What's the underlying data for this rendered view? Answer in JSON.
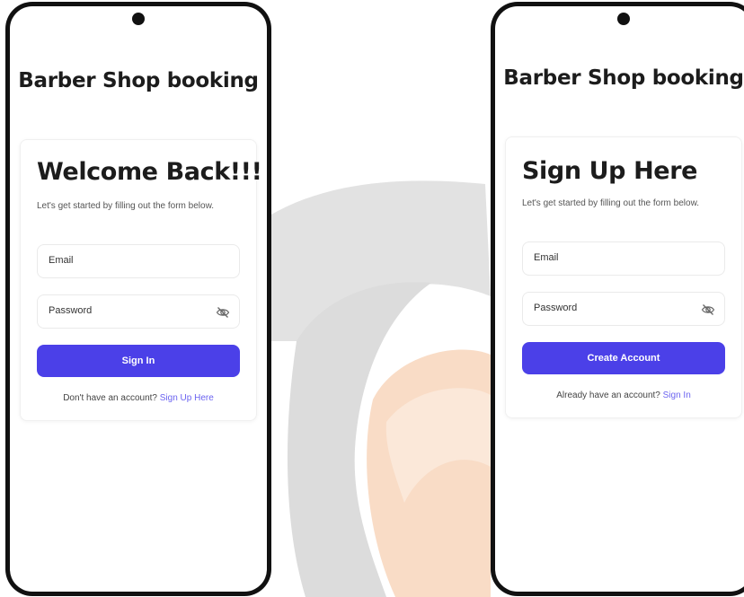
{
  "colors": {
    "primary": "#4b40e8",
    "link": "#6b63f0",
    "phone_frame": "#111111",
    "watermark_gray": "#d6d6d6",
    "watermark_orange": "#f7d2b8"
  },
  "screens": [
    {
      "app_title": "Barber Shop booking",
      "card_title": "Welcome Back!!!",
      "subtitle": "Let's get started by filling out the form below.",
      "email_placeholder": "Email",
      "password_placeholder": "Password",
      "password_toggle_icon": "eye-off-icon",
      "primary_button": "Sign In",
      "footer_prompt": "Don't have an account?",
      "footer_link": "Sign Up Here"
    },
    {
      "app_title": "Barber Shop booking",
      "card_title": "Sign Up Here",
      "subtitle": "Let's get started by filling out the form below.",
      "email_placeholder": "Email",
      "password_placeholder": "Password",
      "password_toggle_icon": "eye-off-icon",
      "primary_button": "Create Account",
      "footer_prompt": "Already have an account?",
      "footer_link": "Sign In"
    }
  ]
}
